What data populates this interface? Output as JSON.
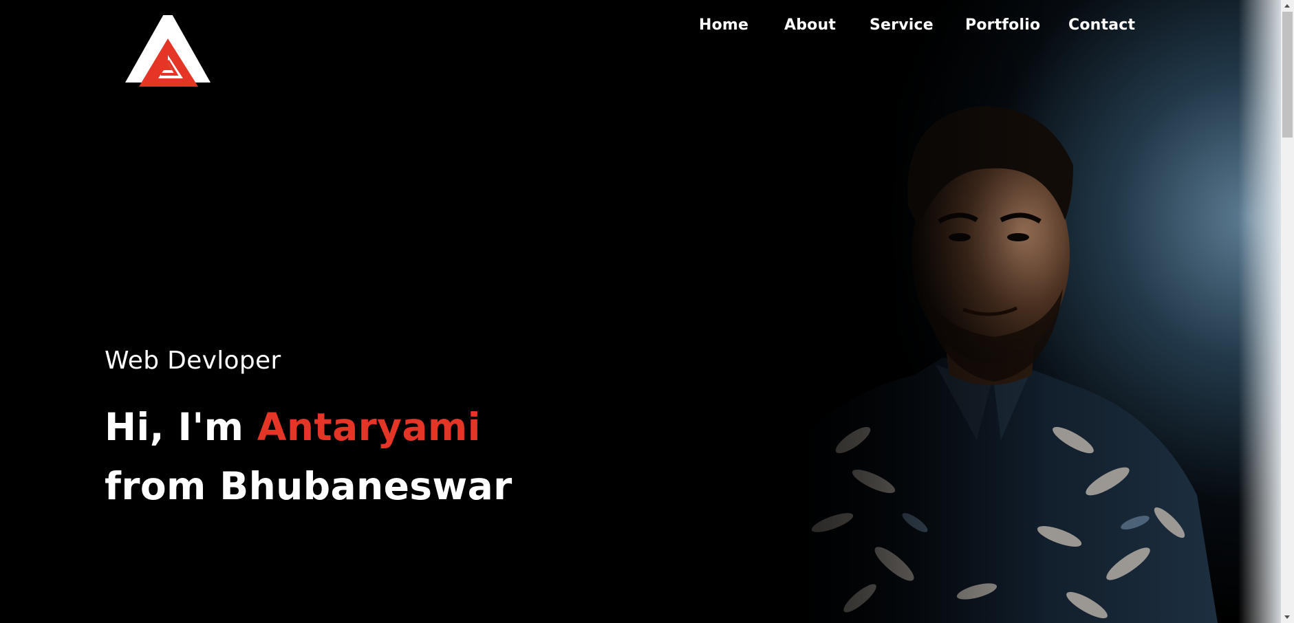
{
  "brand": {
    "logo_icon": "triangle-logo-icon",
    "colors": {
      "accent": "#e53527",
      "text": "#ffffff",
      "background": "#000000"
    }
  },
  "nav": {
    "items": [
      {
        "label": "Home"
      },
      {
        "label": "About"
      },
      {
        "label": "Service"
      },
      {
        "label": "Portfolio"
      },
      {
        "label": "Contact"
      }
    ]
  },
  "hero": {
    "subtitle": "Web Devloper",
    "greeting": "Hi, I'm ",
    "name": "Antaryami",
    "location_line": "from Bhubaneswar"
  }
}
